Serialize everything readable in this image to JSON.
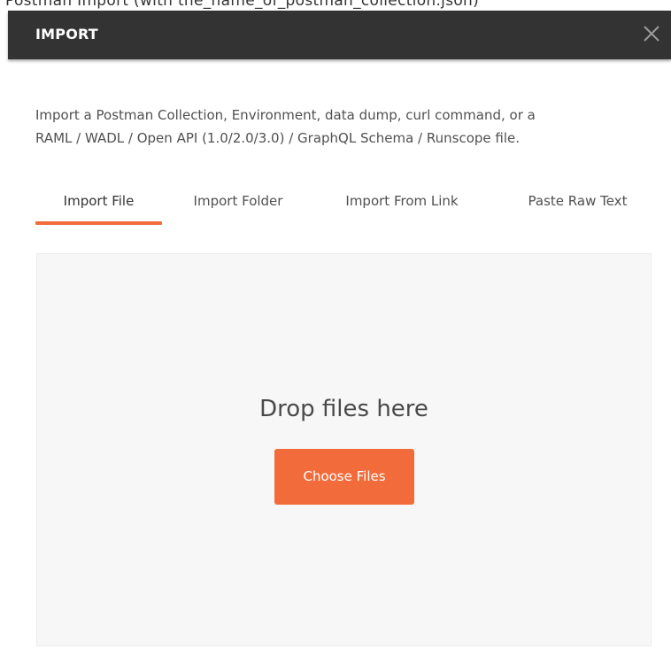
{
  "top_strip": {
    "text": "Postman Import (with the_name_of_postman_collection.json)"
  },
  "modal": {
    "title": "IMPORT",
    "close_icon": "close-icon",
    "description_line1": "Import a Postman Collection, Environment, data dump, curl command, or a",
    "description_line2": "RAML / WADL / Open API (1.0/2.0/3.0) / GraphQL Schema / Runscope file.",
    "tabs": [
      {
        "label": "Import File",
        "active": true
      },
      {
        "label": "Import Folder",
        "active": false
      },
      {
        "label": "Import From Link",
        "active": false
      },
      {
        "label": "Paste Raw Text",
        "active": false
      }
    ],
    "dropzone": {
      "text": "Drop files here",
      "button_label": "Choose Files"
    }
  },
  "colors": {
    "header_bg": "#333333",
    "accent": "#f26b3a",
    "dropzone_bg": "#f7f7f7",
    "text": "#505050"
  }
}
